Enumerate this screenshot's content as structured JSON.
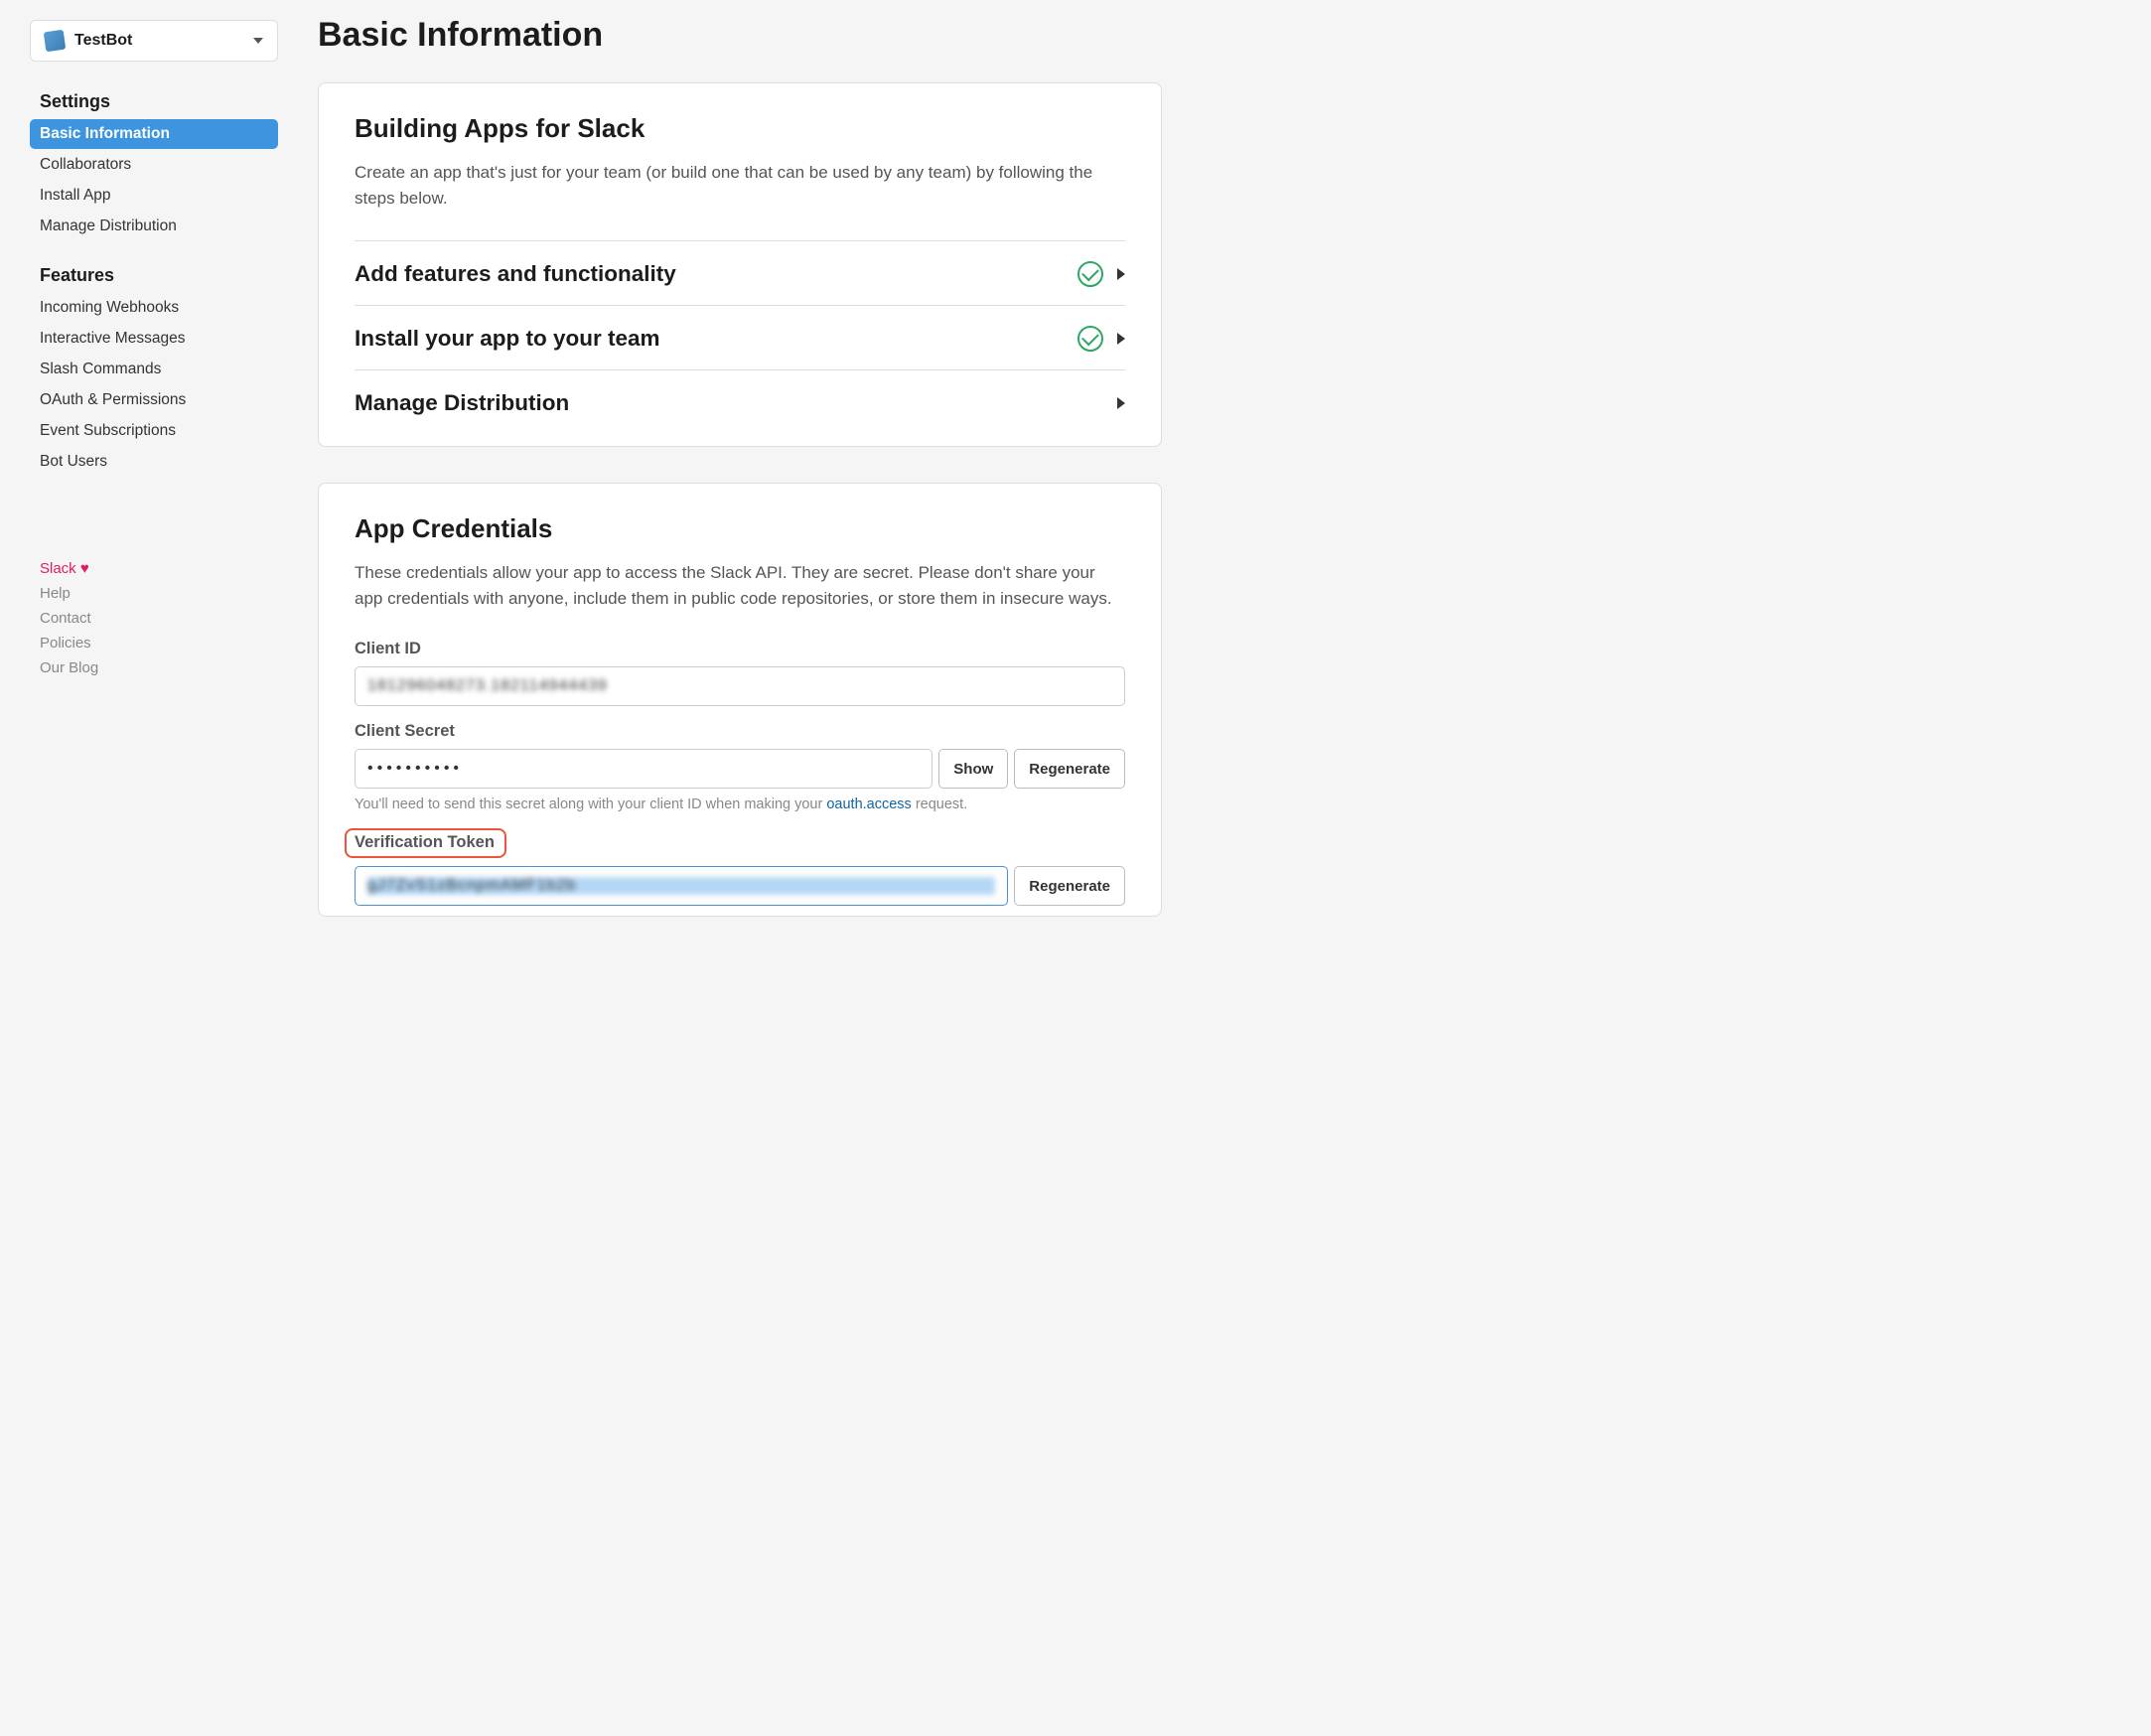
{
  "app": {
    "name": "TestBot"
  },
  "sidebar": {
    "settings_title": "Settings",
    "features_title": "Features",
    "settings": [
      {
        "label": "Basic Information",
        "active": true
      },
      {
        "label": "Collaborators"
      },
      {
        "label": "Install App"
      },
      {
        "label": "Manage Distribution"
      }
    ],
    "features": [
      {
        "label": "Incoming Webhooks"
      },
      {
        "label": "Interactive Messages"
      },
      {
        "label": "Slash Commands"
      },
      {
        "label": "OAuth & Permissions"
      },
      {
        "label": "Event Subscriptions"
      },
      {
        "label": "Bot Users"
      }
    ],
    "footer": {
      "slack": "Slack",
      "help": "Help",
      "contact": "Contact",
      "policies": "Policies",
      "blog": "Our Blog"
    }
  },
  "main": {
    "title": "Basic Information",
    "building": {
      "title": "Building Apps for Slack",
      "desc": "Create an app that's just for your team (or build one that can be used by any team) by following the steps below.",
      "rows": [
        {
          "label": "Add features and functionality",
          "done": true
        },
        {
          "label": "Install your app to your team",
          "done": true
        },
        {
          "label": "Manage Distribution",
          "done": false
        }
      ]
    },
    "credentials": {
      "title": "App Credentials",
      "desc": "These credentials allow your app to access the Slack API. They are secret. Please don't share your app credentials with anyone, include them in public code repositories, or store them in insecure ways.",
      "client_id_label": "Client ID",
      "client_id_value": "181296048273.182114944439",
      "client_secret_label": "Client Secret",
      "client_secret_value": "••••••••••",
      "client_secret_help_pre": "You'll need to send this secret along with your client ID when making your ",
      "client_secret_help_link": "oauth.access",
      "client_secret_help_post": " request.",
      "verification_token_label": "Verification Token",
      "verification_token_value": "gJ7ZvS1zBcnpmAMF1b2b",
      "show_btn": "Show",
      "regenerate_btn": "Regenerate"
    }
  }
}
